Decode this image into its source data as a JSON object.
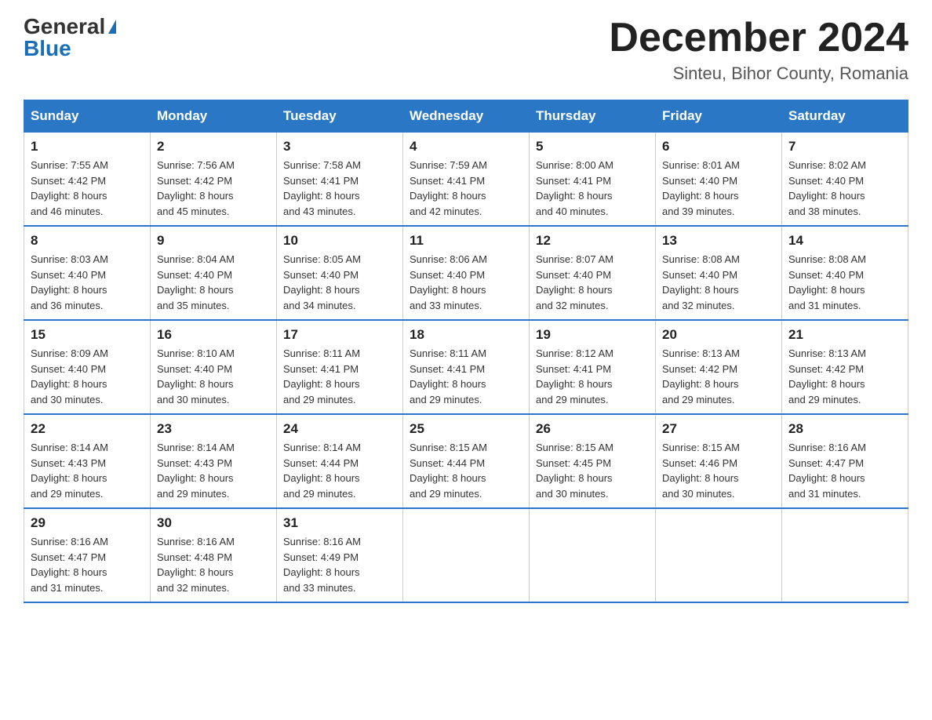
{
  "header": {
    "logo_general": "General",
    "logo_blue": "Blue",
    "month_title": "December 2024",
    "location": "Sinteu, Bihor County, Romania"
  },
  "days_of_week": [
    "Sunday",
    "Monday",
    "Tuesday",
    "Wednesday",
    "Thursday",
    "Friday",
    "Saturday"
  ],
  "weeks": [
    [
      {
        "day": "1",
        "sunrise": "7:55 AM",
        "sunset": "4:42 PM",
        "daylight": "8 hours and 46 minutes."
      },
      {
        "day": "2",
        "sunrise": "7:56 AM",
        "sunset": "4:42 PM",
        "daylight": "8 hours and 45 minutes."
      },
      {
        "day": "3",
        "sunrise": "7:58 AM",
        "sunset": "4:41 PM",
        "daylight": "8 hours and 43 minutes."
      },
      {
        "day": "4",
        "sunrise": "7:59 AM",
        "sunset": "4:41 PM",
        "daylight": "8 hours and 42 minutes."
      },
      {
        "day": "5",
        "sunrise": "8:00 AM",
        "sunset": "4:41 PM",
        "daylight": "8 hours and 40 minutes."
      },
      {
        "day": "6",
        "sunrise": "8:01 AM",
        "sunset": "4:40 PM",
        "daylight": "8 hours and 39 minutes."
      },
      {
        "day": "7",
        "sunrise": "8:02 AM",
        "sunset": "4:40 PM",
        "daylight": "8 hours and 38 minutes."
      }
    ],
    [
      {
        "day": "8",
        "sunrise": "8:03 AM",
        "sunset": "4:40 PM",
        "daylight": "8 hours and 36 minutes."
      },
      {
        "day": "9",
        "sunrise": "8:04 AM",
        "sunset": "4:40 PM",
        "daylight": "8 hours and 35 minutes."
      },
      {
        "day": "10",
        "sunrise": "8:05 AM",
        "sunset": "4:40 PM",
        "daylight": "8 hours and 34 minutes."
      },
      {
        "day": "11",
        "sunrise": "8:06 AM",
        "sunset": "4:40 PM",
        "daylight": "8 hours and 33 minutes."
      },
      {
        "day": "12",
        "sunrise": "8:07 AM",
        "sunset": "4:40 PM",
        "daylight": "8 hours and 32 minutes."
      },
      {
        "day": "13",
        "sunrise": "8:08 AM",
        "sunset": "4:40 PM",
        "daylight": "8 hours and 32 minutes."
      },
      {
        "day": "14",
        "sunrise": "8:08 AM",
        "sunset": "4:40 PM",
        "daylight": "8 hours and 31 minutes."
      }
    ],
    [
      {
        "day": "15",
        "sunrise": "8:09 AM",
        "sunset": "4:40 PM",
        "daylight": "8 hours and 30 minutes."
      },
      {
        "day": "16",
        "sunrise": "8:10 AM",
        "sunset": "4:40 PM",
        "daylight": "8 hours and 30 minutes."
      },
      {
        "day": "17",
        "sunrise": "8:11 AM",
        "sunset": "4:41 PM",
        "daylight": "8 hours and 29 minutes."
      },
      {
        "day": "18",
        "sunrise": "8:11 AM",
        "sunset": "4:41 PM",
        "daylight": "8 hours and 29 minutes."
      },
      {
        "day": "19",
        "sunrise": "8:12 AM",
        "sunset": "4:41 PM",
        "daylight": "8 hours and 29 minutes."
      },
      {
        "day": "20",
        "sunrise": "8:13 AM",
        "sunset": "4:42 PM",
        "daylight": "8 hours and 29 minutes."
      },
      {
        "day": "21",
        "sunrise": "8:13 AM",
        "sunset": "4:42 PM",
        "daylight": "8 hours and 29 minutes."
      }
    ],
    [
      {
        "day": "22",
        "sunrise": "8:14 AM",
        "sunset": "4:43 PM",
        "daylight": "8 hours and 29 minutes."
      },
      {
        "day": "23",
        "sunrise": "8:14 AM",
        "sunset": "4:43 PM",
        "daylight": "8 hours and 29 minutes."
      },
      {
        "day": "24",
        "sunrise": "8:14 AM",
        "sunset": "4:44 PM",
        "daylight": "8 hours and 29 minutes."
      },
      {
        "day": "25",
        "sunrise": "8:15 AM",
        "sunset": "4:44 PM",
        "daylight": "8 hours and 29 minutes."
      },
      {
        "day": "26",
        "sunrise": "8:15 AM",
        "sunset": "4:45 PM",
        "daylight": "8 hours and 30 minutes."
      },
      {
        "day": "27",
        "sunrise": "8:15 AM",
        "sunset": "4:46 PM",
        "daylight": "8 hours and 30 minutes."
      },
      {
        "day": "28",
        "sunrise": "8:16 AM",
        "sunset": "4:47 PM",
        "daylight": "8 hours and 31 minutes."
      }
    ],
    [
      {
        "day": "29",
        "sunrise": "8:16 AM",
        "sunset": "4:47 PM",
        "daylight": "8 hours and 31 minutes."
      },
      {
        "day": "30",
        "sunrise": "8:16 AM",
        "sunset": "4:48 PM",
        "daylight": "8 hours and 32 minutes."
      },
      {
        "day": "31",
        "sunrise": "8:16 AM",
        "sunset": "4:49 PM",
        "daylight": "8 hours and 33 minutes."
      },
      null,
      null,
      null,
      null
    ]
  ],
  "labels": {
    "sunrise": "Sunrise:",
    "sunset": "Sunset:",
    "daylight": "Daylight:"
  }
}
